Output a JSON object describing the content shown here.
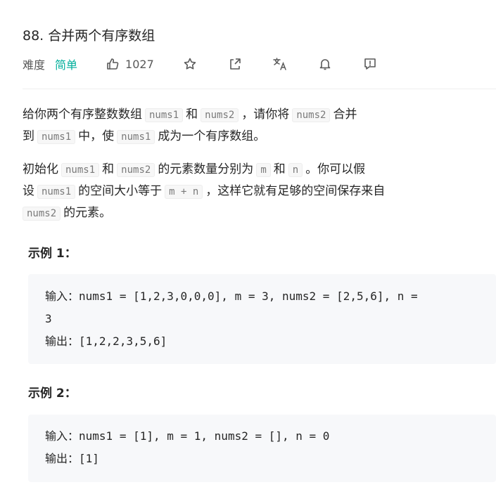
{
  "problem": {
    "title": "88. 合并两个有序数组",
    "difficulty_label": "难度",
    "difficulty": "简单",
    "likes": "1027",
    "icons": [
      "thumbs-up-icon",
      "star-icon",
      "share-icon",
      "translate-icon",
      "bell-icon",
      "feedback-icon"
    ]
  },
  "description": {
    "p1": {
      "t1": "给你两个有序整数数组",
      "c1": "nums1",
      "t2": "和",
      "c2": "nums2",
      "t3": "，请你将",
      "c3": "nums2",
      "t4": "合并",
      "t5": "到",
      "c4": "nums1",
      "t6": "中，使",
      "c5": "nums1",
      "t7": "成为一个有序数组。"
    },
    "p2": {
      "t1": "初始化",
      "c1": "nums1",
      "t2": "和",
      "c2": "nums2",
      "t3": "的元素数量分别为",
      "c3": "m",
      "t4": "和",
      "c4": "n",
      "t5": "。你可以假",
      "t6": "设",
      "c5": "nums1",
      "t7": "的空间大小等于",
      "c6": "m + n",
      "t8": "，这样它就有足够的空间保存来自",
      "c7": "nums2",
      "t9": "的元素。"
    }
  },
  "examples": [
    {
      "title": "示例 1：",
      "input_label": "输入：",
      "input": "nums1 = [1,2,3,0,0,0], m = 3, nums2 = [2,5,6], n =",
      "input_cont": "3",
      "output_label": "输出：",
      "output": "[1,2,2,3,5,6]"
    },
    {
      "title": "示例 2：",
      "input_label": "输入：",
      "input": "nums1 = [1], m = 1, nums2 = [], n = 0",
      "output_label": "输出：",
      "output": "[1]"
    }
  ],
  "colors": {
    "easy": "#00af9b",
    "text": "#262626",
    "muted": "#595959",
    "code_bg": "#f7f7f7",
    "example_bg": "#f7f8fa"
  }
}
